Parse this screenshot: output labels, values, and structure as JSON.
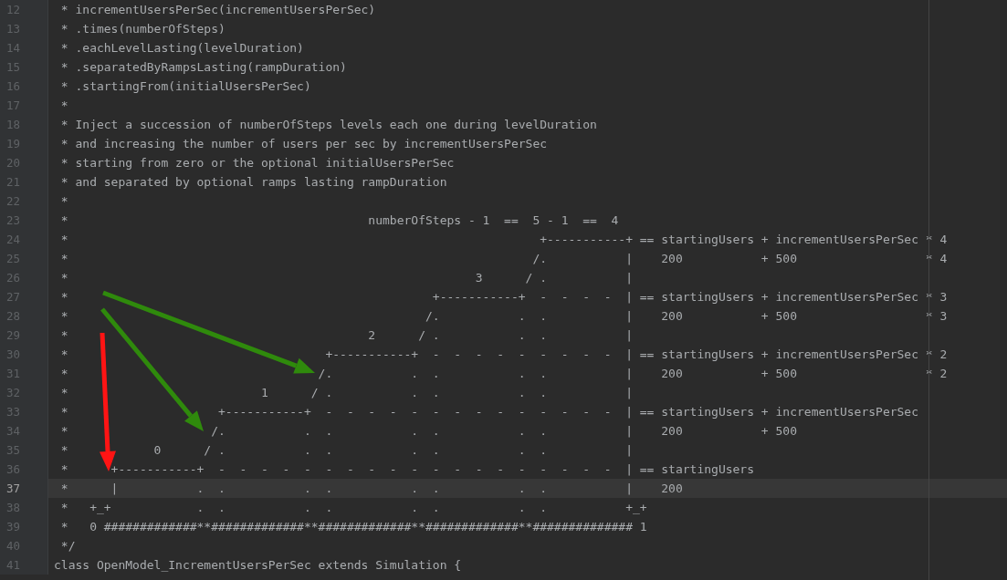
{
  "lines": [
    {
      "number": "12",
      "text": " * incrementUsersPerSec(incrementUsersPerSec)",
      "current": false
    },
    {
      "number": "13",
      "text": " * .times(numberOfSteps)",
      "current": false
    },
    {
      "number": "14",
      "text": " * .eachLevelLasting(levelDuration)",
      "current": false
    },
    {
      "number": "15",
      "text": " * .separatedByRampsLasting(rampDuration)",
      "current": false
    },
    {
      "number": "16",
      "text": " * .startingFrom(initialUsersPerSec)",
      "current": false
    },
    {
      "number": "17",
      "text": " *",
      "current": false
    },
    {
      "number": "18",
      "text": " * Inject a succession of numberOfSteps levels each one during levelDuration",
      "current": false
    },
    {
      "number": "19",
      "text": " * and increasing the number of users per sec by incrementUsersPerSec",
      "current": false
    },
    {
      "number": "20",
      "text": " * starting from zero or the optional initialUsersPerSec",
      "current": false
    },
    {
      "number": "21",
      "text": " * and separated by optional ramps lasting rampDuration",
      "current": false
    },
    {
      "number": "22",
      "text": " *",
      "current": false
    },
    {
      "number": "23",
      "text": " *                                          numberOfSteps - 1  ==  5 - 1  ==  4",
      "current": false
    },
    {
      "number": "24",
      "text": " *                                                                  +-----------+ == startingUsers + incrementUsersPerSec * 4",
      "current": false
    },
    {
      "number": "25",
      "text": " *                                                                 /.           |    200           + 500                  * 4",
      "current": false
    },
    {
      "number": "26",
      "text": " *                                                         3      / .           |",
      "current": false
    },
    {
      "number": "27",
      "text": " *                                                   +-----------+  -  -  -  -  | == startingUsers + incrementUsersPerSec * 3",
      "current": false
    },
    {
      "number": "28",
      "text": " *                                                  /.           .  .           |    200           + 500                  * 3",
      "current": false
    },
    {
      "number": "29",
      "text": " *                                          2      / .           .  .           |",
      "current": false
    },
    {
      "number": "30",
      "text": " *                                    +-----------+  -  -  -  -  -  -  -  -  -  | == startingUsers + incrementUsersPerSec * 2",
      "current": false
    },
    {
      "number": "31",
      "text": " *                                   /.           .  .           .  .           |    200           + 500                  * 2",
      "current": false
    },
    {
      "number": "32",
      "text": " *                           1      / .           .  .           .  .           |",
      "current": false
    },
    {
      "number": "33",
      "text": " *                     +-----------+  -  -  -  -  -  -  -  -  -  -  -  -  -  -  | == startingUsers + incrementUsersPerSec",
      "current": false
    },
    {
      "number": "34",
      "text": " *                    /.           .  .           .  .           .  .           |    200           + 500",
      "current": false
    },
    {
      "number": "35",
      "text": " *            0      / .           .  .           .  .           .  .           |",
      "current": false
    },
    {
      "number": "36",
      "text": " *      +-----------+  -  -  -  -  -  -  -  -  -  -  -  -  -  -  -  -  -  -  -  | == startingUsers",
      "current": false
    },
    {
      "number": "37",
      "text": " *      |           .  .           .  .           .  .           .  .           |    200",
      "current": true
    },
    {
      "number": "38",
      "text": " *   +_+            .  .           .  .           .  .           .  .           +_+",
      "current": false
    },
    {
      "number": "39",
      "text": " *   0 #############**#############**#############**#############**############## 1",
      "current": false
    },
    {
      "number": "40",
      "text": " */",
      "current": false
    },
    {
      "number": "41",
      "text": "class OpenModel_IncrementUsersPerSec extends Simulation {",
      "current": false
    }
  ],
  "annotations": [
    {
      "kind": "arrow",
      "color": "#2f8a0c"
    },
    {
      "kind": "arrow",
      "color": "#2f8a0c"
    },
    {
      "kind": "arrow",
      "color": "#ff1414"
    }
  ]
}
